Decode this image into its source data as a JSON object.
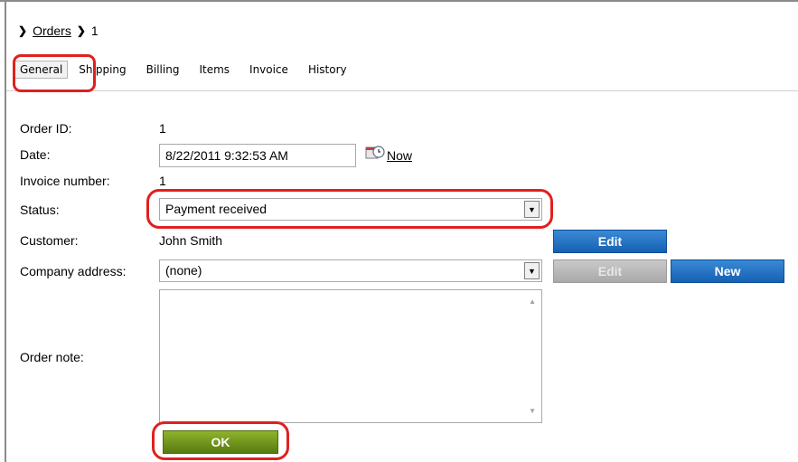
{
  "breadcrumb": {
    "parent": "Orders",
    "current": "1"
  },
  "tabs": [
    {
      "label": "General",
      "active": true
    },
    {
      "label": "Shipping"
    },
    {
      "label": "Billing"
    },
    {
      "label": "Items"
    },
    {
      "label": "Invoice"
    },
    {
      "label": "History"
    }
  ],
  "form": {
    "order_id_label": "Order ID:",
    "order_id_value": "1",
    "date_label": "Date:",
    "date_value": "8/22/2011 9:32:53 AM",
    "now_link": "Now",
    "invoice_label": "Invoice number:",
    "invoice_value": "1",
    "status_label": "Status:",
    "status_value": "Payment received",
    "customer_label": "Customer:",
    "customer_value": "John Smith",
    "customer_edit": "Edit",
    "company_label": "Company address:",
    "company_value": "(none)",
    "company_edit": "Edit",
    "company_new": "New",
    "note_label": "Order note:",
    "note_value": "",
    "ok_button": "OK"
  },
  "colors": {
    "highlight": "#e02020",
    "blue_button": "#1560b3",
    "green_button": "#567a0f"
  }
}
